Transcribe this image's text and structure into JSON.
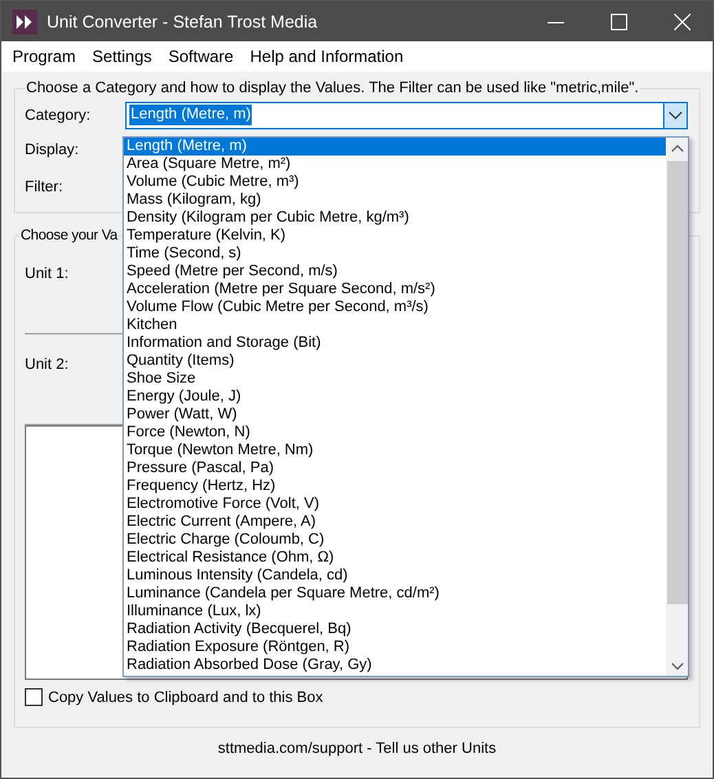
{
  "window": {
    "title": "Unit Converter - Stefan Trost Media"
  },
  "menu": [
    "Program",
    "Settings",
    "Software",
    "Help and Information"
  ],
  "category_group": {
    "title": "Choose a Category and how to display the Values. The Filter can be used like \"metric,mile\".",
    "labels": [
      "Category:",
      "Display:",
      "Filter:"
    ],
    "category_value": "Length (Metre, m)"
  },
  "category_list": [
    {
      "label": "Length (Metre, m)",
      "selected": true
    },
    {
      "label": "Area (Square Metre, m²)",
      "selected": false
    },
    {
      "label": "Volume (Cubic Metre, m³)",
      "selected": false
    },
    {
      "label": "Mass (Kilogram, kg)",
      "selected": false
    },
    {
      "label": "Density (Kilogram per Cubic Metre, kg/m³)",
      "selected": false
    },
    {
      "label": "Temperature (Kelvin, K)",
      "selected": false
    },
    {
      "label": "Time (Second, s)",
      "selected": false
    },
    {
      "label": "Speed (Metre per Second, m/s)",
      "selected": false
    },
    {
      "label": "Acceleration (Metre per Square Second, m/s²)",
      "selected": false
    },
    {
      "label": "Volume Flow (Cubic Metre per Second, m³/s)",
      "selected": false
    },
    {
      "label": "Kitchen",
      "selected": false
    },
    {
      "label": "Information and Storage (Bit)",
      "selected": false
    },
    {
      "label": "Quantity (Items)",
      "selected": false
    },
    {
      "label": "Shoe Size",
      "selected": false
    },
    {
      "label": "Energy (Joule, J)",
      "selected": false
    },
    {
      "label": "Power (Watt, W)",
      "selected": false
    },
    {
      "label": "Force (Newton, N)",
      "selected": false
    },
    {
      "label": "Torque (Newton Metre, Nm)",
      "selected": false
    },
    {
      "label": "Pressure (Pascal, Pa)",
      "selected": false
    },
    {
      "label": "Frequency (Hertz, Hz)",
      "selected": false
    },
    {
      "label": "Electromotive Force (Volt, V)",
      "selected": false
    },
    {
      "label": "Electric Current (Ampere, A)",
      "selected": false
    },
    {
      "label": "Electric Charge (Coloumb, C)",
      "selected": false
    },
    {
      "label": "Electrical Resistance (Ohm, Ω)",
      "selected": false
    },
    {
      "label": "Luminous Intensity (Candela, cd)",
      "selected": false
    },
    {
      "label": "Luminance (Candela per Square Metre, cd/m²)",
      "selected": false
    },
    {
      "label": "Illuminance (Lux, lx)",
      "selected": false
    },
    {
      "label": "Radiation Activity (Becquerel, Bq)",
      "selected": false
    },
    {
      "label": "Radiation Exposure (Röntgen, R)",
      "selected": false
    },
    {
      "label": "Radiation Absorbed Dose (Gray, Gy)",
      "selected": false
    }
  ],
  "values_group": {
    "title": "Choose your Va",
    "unit_labels": [
      "Unit 1:",
      "Unit 2:"
    ]
  },
  "copy_checkbox": {
    "label": "Copy Values to Clipboard and to this Box",
    "checked": false
  },
  "footer": "sttmedia.com/support - Tell us other Units"
}
